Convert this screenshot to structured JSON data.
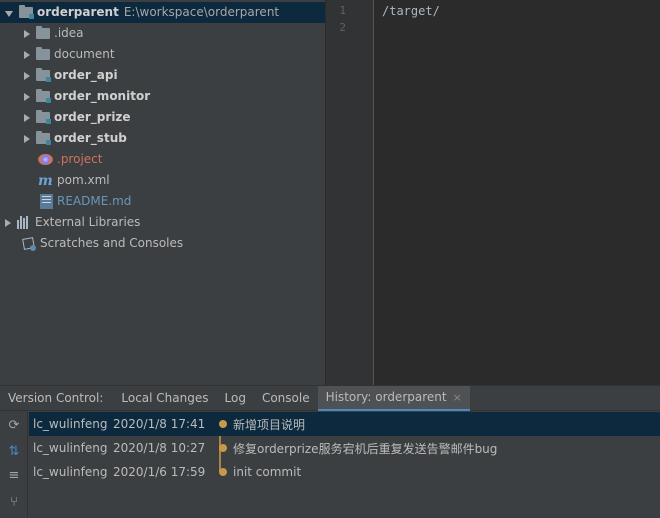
{
  "project": {
    "root_name": "orderparent",
    "root_path": "E:\\workspace\\orderparent",
    "children": [
      {
        "name": ".idea"
      },
      {
        "name": "document"
      },
      {
        "name": "order_api"
      },
      {
        "name": "order_monitor"
      },
      {
        "name": "order_prize"
      },
      {
        "name": "order_stub"
      },
      {
        "name": ".project"
      },
      {
        "name": "pom.xml"
      },
      {
        "name": "README.md"
      }
    ],
    "external_libraries": "External Libraries",
    "scratches": "Scratches and Consoles"
  },
  "editor": {
    "line_numbers": [
      "1",
      "2"
    ],
    "lines": [
      "/target/",
      ""
    ]
  },
  "bottom_panel": {
    "tabs": {
      "version_control": "Version Control:",
      "local_changes": "Local Changes",
      "log": "Log",
      "console": "Console",
      "history": "History: orderparent",
      "close": "×"
    },
    "history": [
      {
        "author": "lc_wulinfeng",
        "date": "2020/1/8 17:41",
        "message": "新增项目说明"
      },
      {
        "author": "lc_wulinfeng",
        "date": "2020/1/8 10:27",
        "message": "修复orderprize服务宕机后重复发送告警邮件bug"
      },
      {
        "author": "lc_wulinfeng",
        "date": "2020/1/6 17:59",
        "message": "init commit"
      }
    ]
  },
  "colors": {
    "selection": "#0d293e",
    "tab_accent": "#4a88c7",
    "commit_dot": "#c59a4b"
  }
}
